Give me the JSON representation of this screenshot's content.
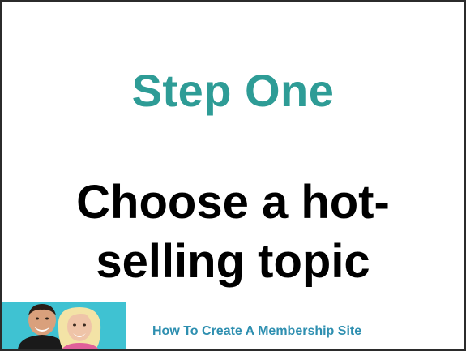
{
  "slide": {
    "heading": "Step One",
    "body_line1": "Choose a hot-",
    "body_line2": "selling topic",
    "footer": "How To Create A Membership Site"
  },
  "colors": {
    "heading": "#2e9c96",
    "body": "#000000",
    "footer": "#2e8fb0",
    "photo_background": "#3fc2d2",
    "border": "#2b2b2b"
  }
}
